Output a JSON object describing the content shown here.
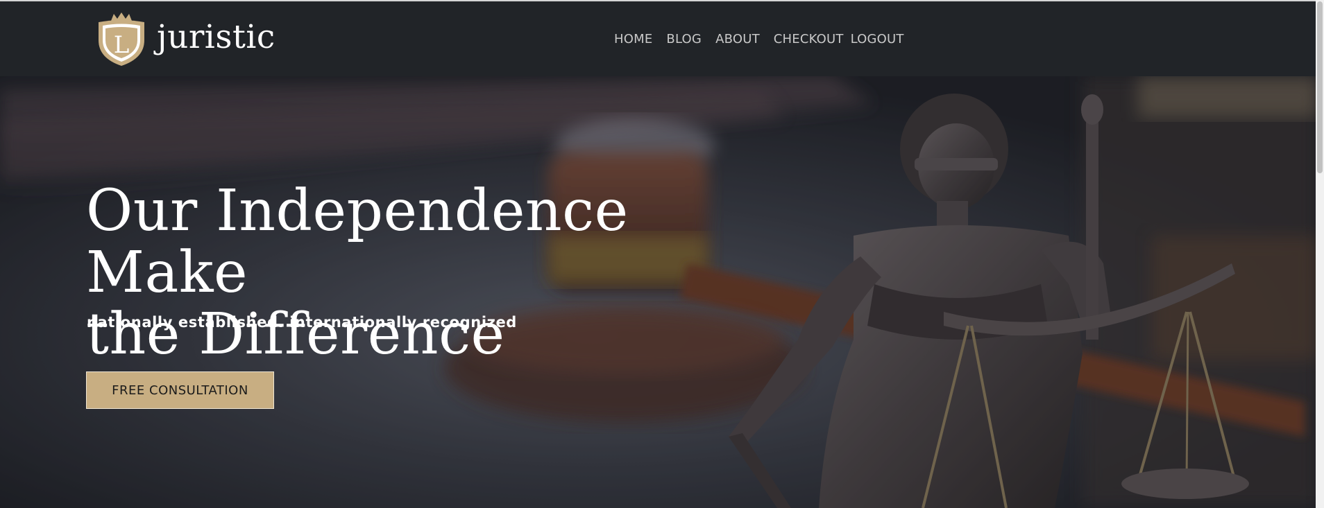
{
  "brand": {
    "name": "juristic",
    "logo_letter": "L"
  },
  "nav": {
    "items": [
      {
        "label": "HOME"
      },
      {
        "label": "BLOG"
      },
      {
        "label": "ABOUT"
      },
      {
        "label": "CHECKOUT"
      },
      {
        "label": "LOGOUT"
      }
    ]
  },
  "hero": {
    "title": "Our Independence Make\nthe Difference",
    "subtitle": "nationally established. internationally recognized",
    "cta_label": "FREE CONSULTATION",
    "background_image": "lady-justice-statue-with-gavel-photo"
  },
  "colors": {
    "header_bg": "#212428",
    "accent_gold": "#c8ae82",
    "text_white": "#ffffff",
    "nav_text": "#c9c9c9"
  }
}
